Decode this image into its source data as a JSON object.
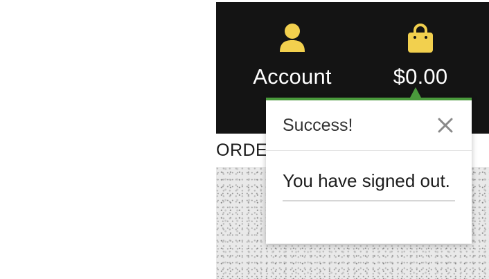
{
  "header": {
    "account": {
      "label": "Account",
      "icon": "user-icon"
    },
    "cart": {
      "label": "$0.00",
      "icon": "shopping-bag-icon"
    }
  },
  "nav": {
    "partial_text": "ORDE"
  },
  "popover": {
    "title": "Success!",
    "close_icon": "close-icon",
    "message": "You have signed out."
  },
  "colors": {
    "header_bg": "#141414",
    "icon_yellow": "#F2D04E",
    "accent_green": "#4A9A3C"
  }
}
